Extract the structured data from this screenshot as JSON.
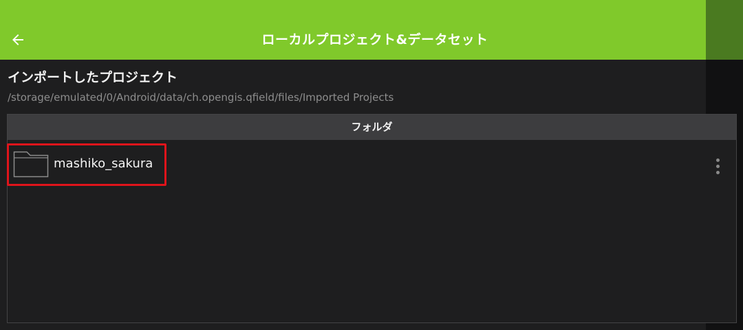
{
  "header": {
    "title": "ローカルプロジェクト&データセット",
    "back_icon": "arrow-left-icon",
    "color": "#80c92b"
  },
  "section": {
    "title": "インポートしたプロジェクト",
    "path": "/storage/emulated/0/Android/data/ch.opengis.qfield/files/Imported Projects"
  },
  "table": {
    "header": "フォルダ",
    "rows": [
      {
        "label": "mashiko_sakura",
        "icon": "folder-icon",
        "menu_icon": "more-vert-icon"
      }
    ]
  },
  "colors": {
    "background": "#1e1e1f",
    "highlight": "#e0141b"
  }
}
